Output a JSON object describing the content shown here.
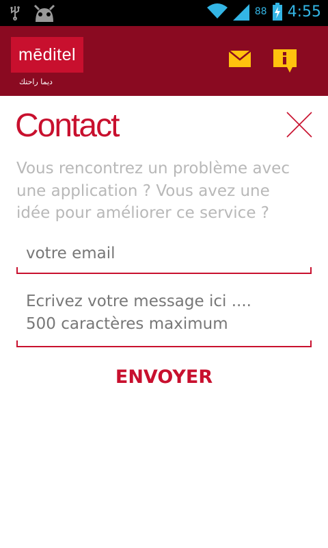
{
  "status_bar": {
    "battery_percent": "88",
    "time": "4:55",
    "icons": [
      "usb-icon",
      "android-debug-icon",
      "wifi-icon",
      "signal-icon",
      "battery-charging-icon"
    ]
  },
  "header": {
    "logo_text": "mēditel",
    "logo_tagline": "ديما راحتك",
    "icons": [
      "mail-icon",
      "info-icon"
    ]
  },
  "contact": {
    "title": "Contact",
    "intro_lines": [
      "Vous rencontrez un problème avec",
      "une application ? Vous avez une",
      "idée pour améliorer ce service ?"
    ],
    "email_placeholder": "votre email",
    "message_placeholder": "Ecrivez votre message ici ....\n500 caractères maximum",
    "send_label": "ENVOYER"
  },
  "colors": {
    "brand_red": "#c8102e",
    "header_bg": "#8a0a21",
    "accent_yellow": "#ffc20e",
    "status_blue": "#33b5e5",
    "intro_gray": "#b8b8b8"
  }
}
